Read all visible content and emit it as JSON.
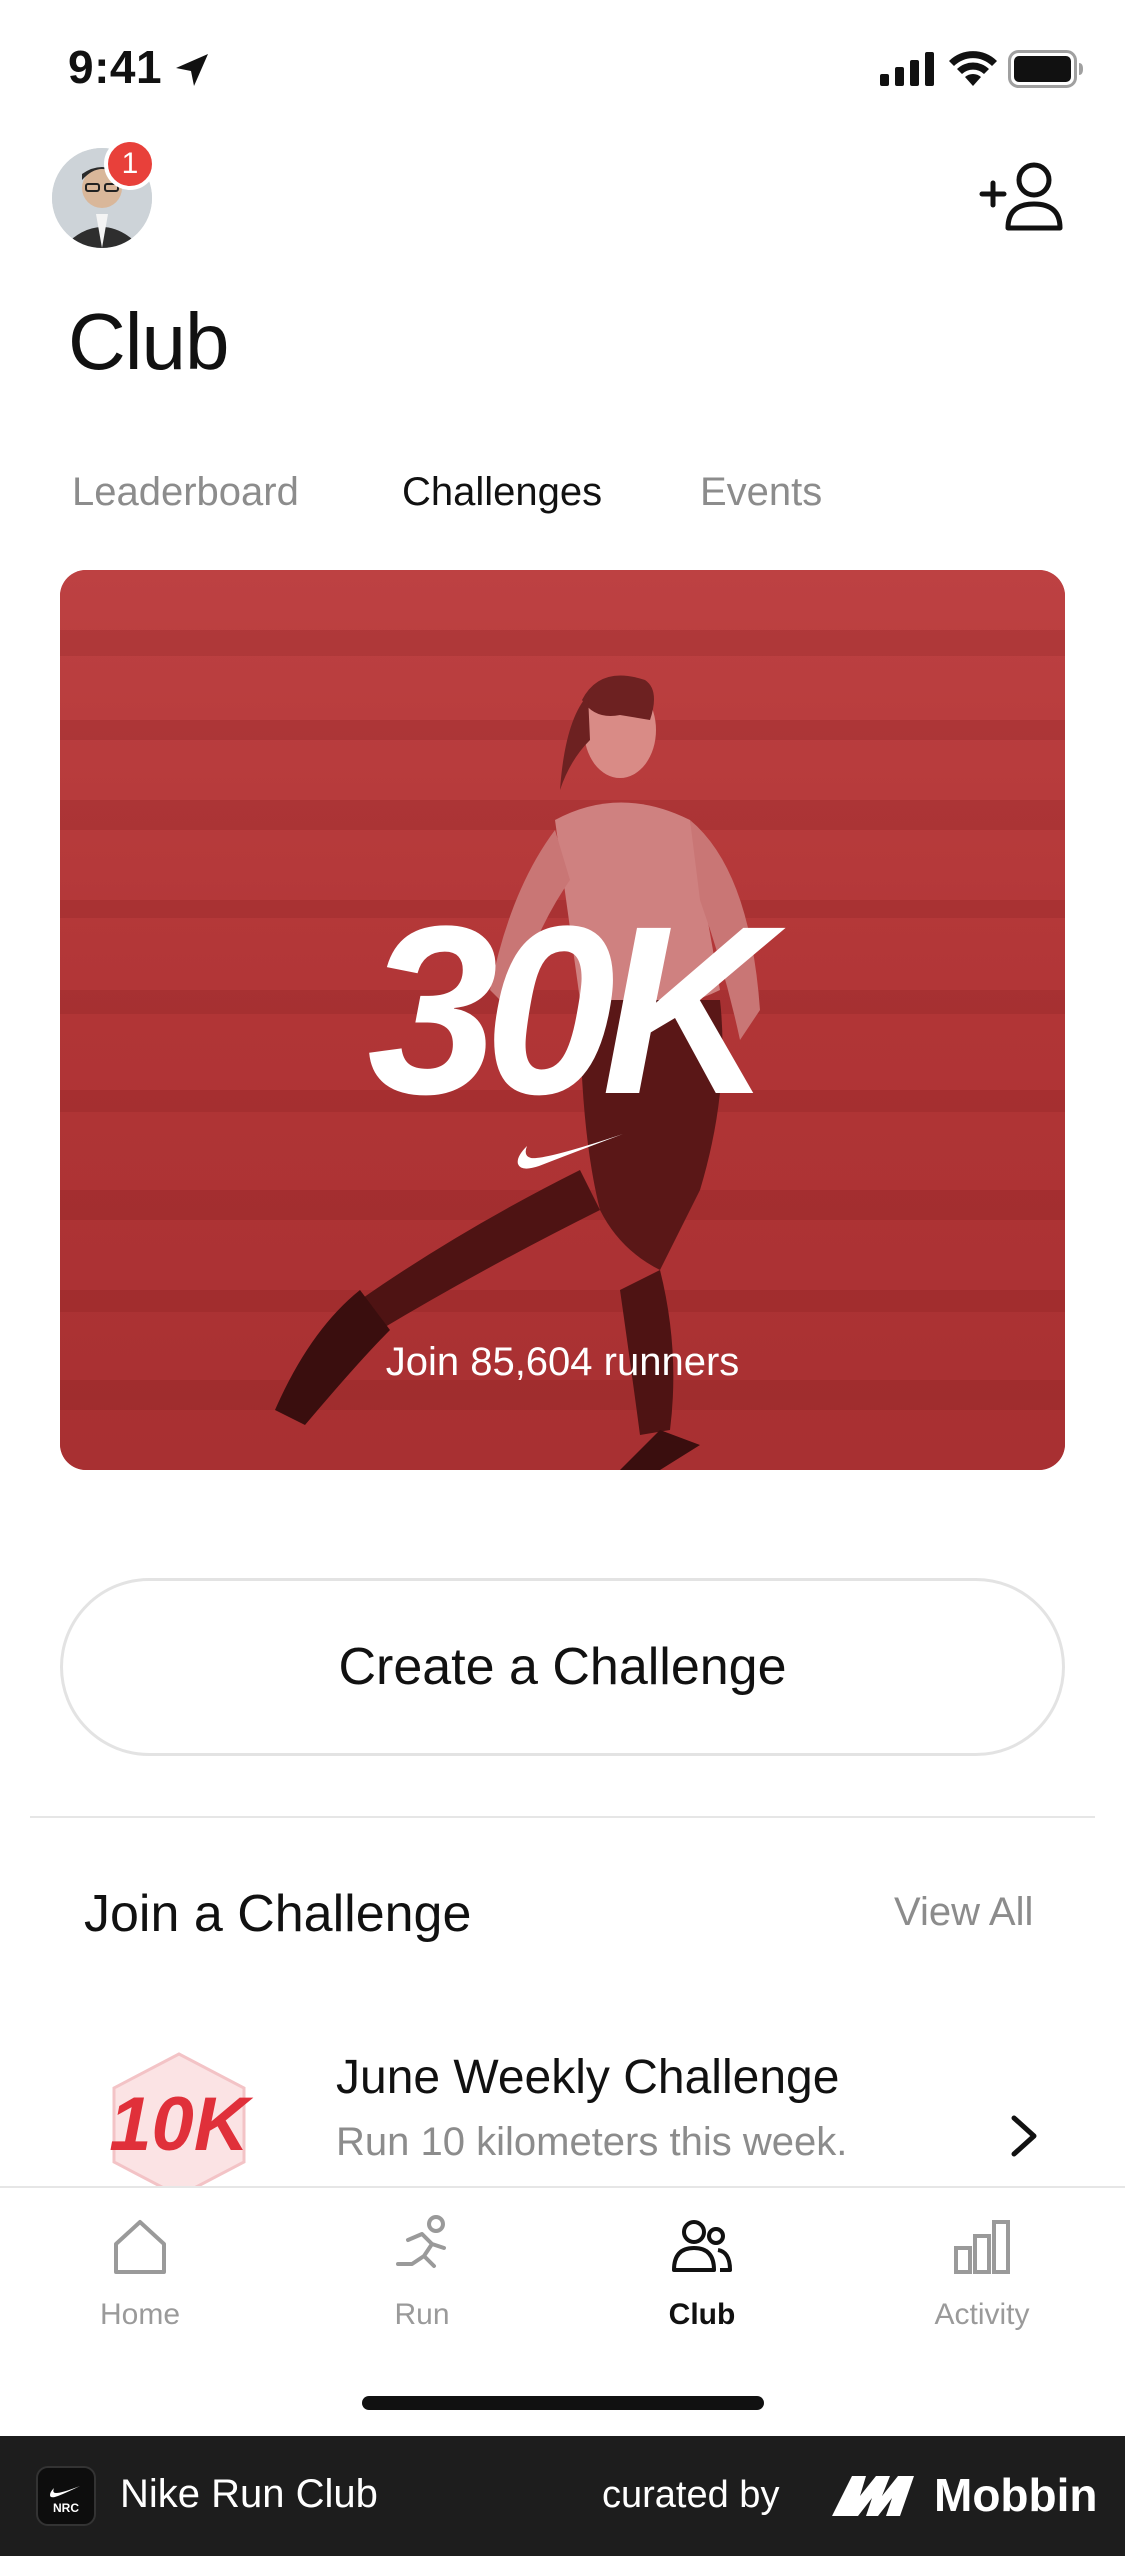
{
  "status_bar": {
    "time": "9:41"
  },
  "header": {
    "notification_count": "1",
    "title": "Club"
  },
  "tabs": [
    {
      "label": "Leaderboard",
      "active": false
    },
    {
      "label": "Challenges",
      "active": true
    },
    {
      "label": "Events",
      "active": false
    }
  ],
  "hero": {
    "title": "30K",
    "caption": "Join 85,604 runners",
    "tint_color": "#b8393a"
  },
  "create_button": {
    "label": "Create a Challenge"
  },
  "join_section": {
    "title": "Join a Challenge",
    "view_all": "View All",
    "challenges": [
      {
        "badge_text": "10K",
        "title": "June Weekly Challenge",
        "subtitle": "Run 10 kilometers this week.",
        "icon": "chevron-right-icon"
      }
    ]
  },
  "nav": [
    {
      "label": "Home",
      "icon": "home-icon",
      "active": false
    },
    {
      "label": "Run",
      "icon": "run-icon",
      "active": false
    },
    {
      "label": "Club",
      "icon": "club-icon",
      "active": true
    },
    {
      "label": "Activity",
      "icon": "activity-icon",
      "active": false
    }
  ],
  "footer": {
    "app_name": "Nike Run Club",
    "curated_label": "curated by",
    "brand": "Mobbin"
  },
  "colors": {
    "accent_red": "#e8403a",
    "text_primary": "#111111",
    "text_secondary": "#8c8c8c"
  }
}
